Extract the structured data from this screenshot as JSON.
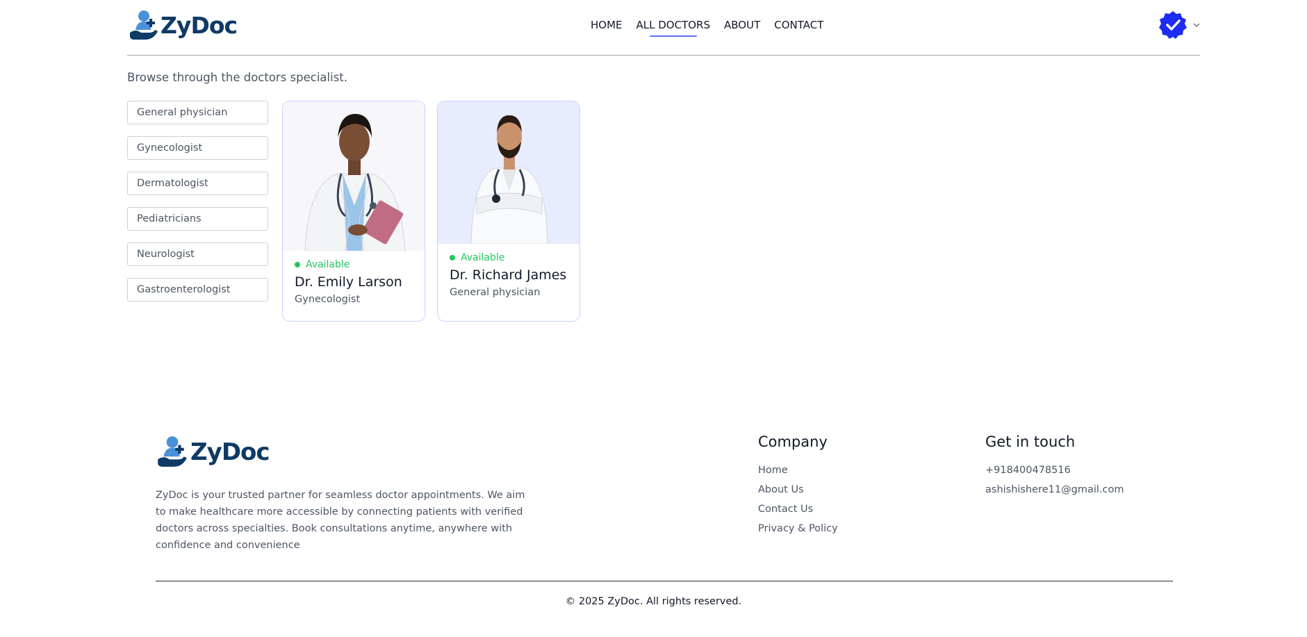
{
  "brand": {
    "name": "ZyDoc",
    "primary": "#5f6fff",
    "navy": "#0f3a66",
    "light_blue": "#4a90d9"
  },
  "nav": {
    "links": [
      {
        "label": "HOME"
      },
      {
        "label": "ALL DOCTORS"
      },
      {
        "label": "ABOUT"
      },
      {
        "label": "CONTACT"
      }
    ],
    "active": "ALL DOCTORS"
  },
  "main": {
    "intro": "Browse through the doctors specialist.",
    "filters": [
      "General physician",
      "Gynecologist",
      "Dermatologist",
      "Pediatricians",
      "Neurologist",
      "Gastroenterologist"
    ],
    "doctors": [
      {
        "status": "Available",
        "name": "Dr. Emily Larson",
        "speciality": "Gynecologist"
      },
      {
        "status": "Available",
        "name": "Dr. Richard James",
        "speciality": "General physician"
      }
    ],
    "status_color": "#22c55e"
  },
  "footer": {
    "description": "ZyDoc is your trusted partner for seamless doctor appointments. We aim to make healthcare more accessible by connecting patients with verified doctors across specialties. Book consultations anytime, anywhere with confidence and convenience",
    "company": {
      "heading": "Company",
      "links": [
        "Home",
        "About Us",
        "Contact Us",
        "Privacy & Policy"
      ]
    },
    "contact": {
      "heading": "Get in touch",
      "phone": "+918400478516",
      "email": "ashishishere11@gmail.com"
    },
    "copyright": "© 2025 ZyDoc. All rights reserved."
  }
}
